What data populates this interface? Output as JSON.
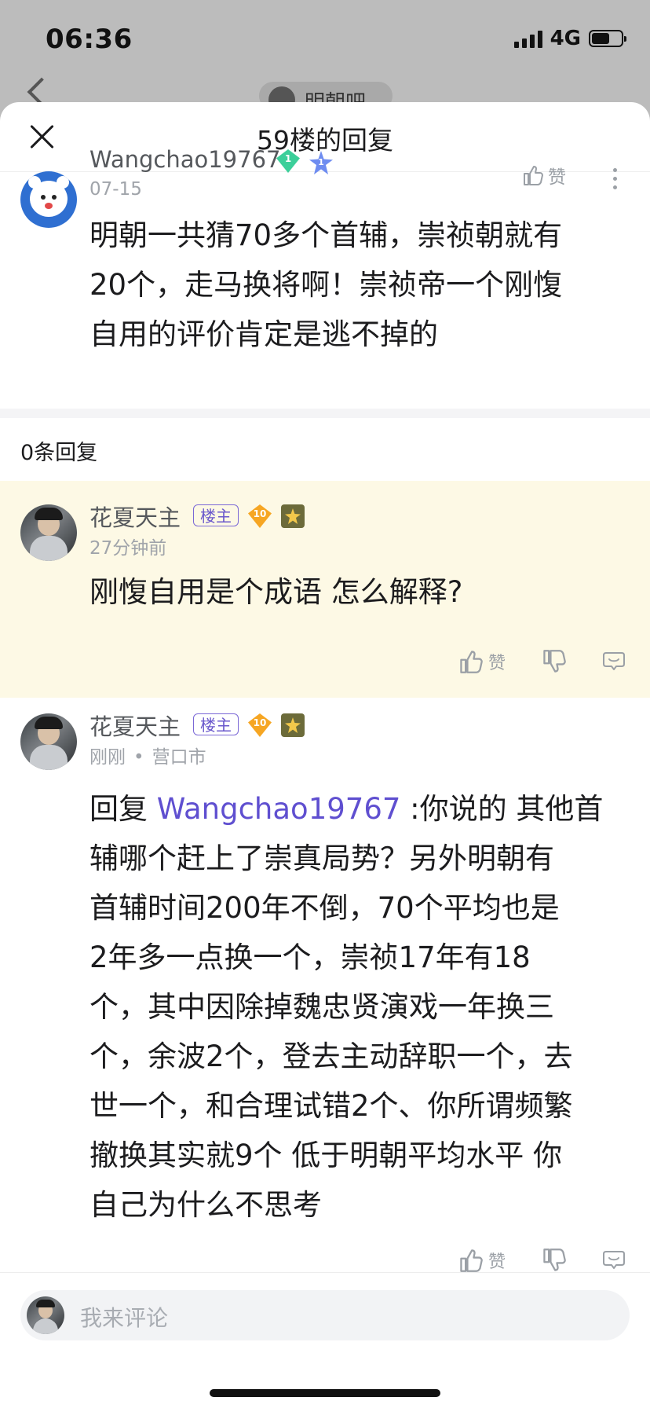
{
  "status_bar": {
    "time": "06:36",
    "network": "4G",
    "battery_level": 0.6
  },
  "background_page": {
    "title_fragment": "明朝吧"
  },
  "sheet": {
    "title": "59楼的回复"
  },
  "main_post": {
    "username": "Wangchao19767",
    "level_badge": "1",
    "rank_badge": "1",
    "date": "07-15",
    "like_label": "赞",
    "lines": [
      "明朝一共猜70多个首辅，崇祯朝就有",
      "20个，走马换将啊！崇祯帝一个刚愎",
      "自用的评价肯定是逃不掉的"
    ]
  },
  "reply_count_label": "0条回复",
  "replies": [
    {
      "username": "花夏天主",
      "owner_tag": "楼主",
      "level_badge": "10",
      "time": "27分钟前",
      "lines": [
        "刚愎自用是个成语 怎么解释?"
      ],
      "like_label": "赞"
    },
    {
      "username": "花夏天主",
      "owner_tag": "楼主",
      "level_badge": "10",
      "time": "刚刚",
      "location": "营口市",
      "reply_prefix": "回复 ",
      "reply_to": "Wangchao19767",
      "first_line_rest": " :你说的 其他首",
      "lines": [
        "辅哪个赶上了崇真局势？另外明朝有",
        "首辅时间200年不倒，70个平均也是",
        "2年多一点换一个，崇祯17年有18",
        "个，其中因除掉魏忠贤演戏一年换三",
        "个，余波2个，登去主动辞职一个，去",
        "世一个，和合理试错2个、你所谓频繁",
        "撤换其实就9个 低于明朝平均水平 你",
        "自己为什么不思考"
      ],
      "like_label": "赞"
    }
  ],
  "comment_bar": {
    "placeholder": "我来评论"
  }
}
